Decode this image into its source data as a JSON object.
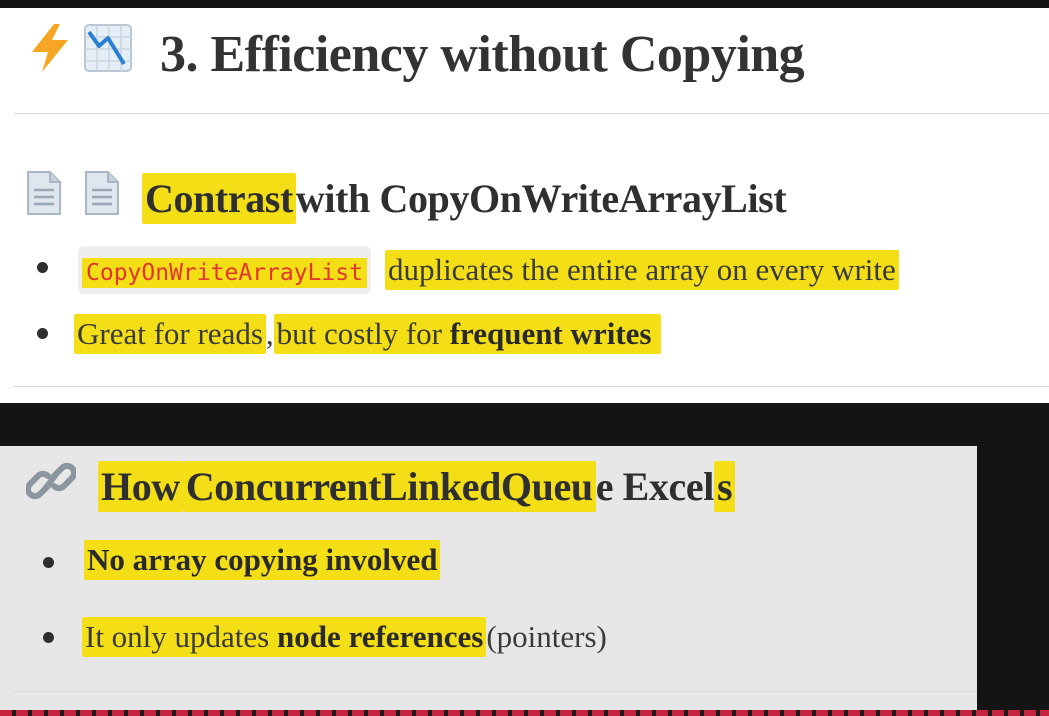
{
  "section_title": {
    "icons": [
      "high-voltage-icon",
      "chart-decreasing-icon"
    ],
    "text": "3. Efficiency without Copying"
  },
  "contrast": {
    "icons": [
      "page-icon",
      "page-icon"
    ],
    "heading_part1": "Contrast",
    "heading_part2": " with CopyOnWriteArrayList",
    "bullet1": {
      "code": "CopyOnWriteArrayList",
      "text": "duplicates the entire array on every write"
    },
    "bullet2": {
      "part1": "Great for reads",
      "part2": ", ",
      "part3": "but costly for ",
      "bold": "frequent writes"
    }
  },
  "excels": {
    "icon": "link-icon",
    "heading_part1": "How ",
    "heading_part2": "ConcurrentLinkedQueu",
    "heading_part3": "e Excel",
    "heading_part4": "s",
    "bullet1": "No array copying involved",
    "bullet2": {
      "part1": "It only updates ",
      "bold": "node references",
      "part2": " (pointers)"
    }
  },
  "colors": {
    "highlight": "#f4df17",
    "code_text": "#e0362f",
    "top_panel": "#ffffff",
    "bottom_panel": "#e7e7e7",
    "background": "#141414"
  }
}
